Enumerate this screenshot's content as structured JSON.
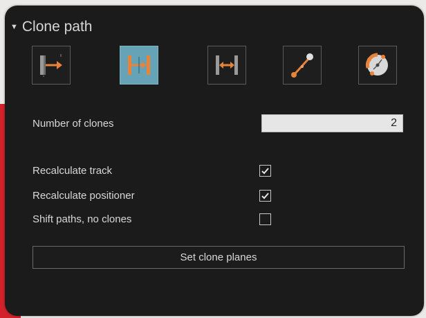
{
  "panel": {
    "title": "Clone path",
    "number_of_clones_label": "Number of clones",
    "number_of_clones_value": "2",
    "options": [
      {
        "label": "Recalculate track",
        "checked": true
      },
      {
        "label": "Recalculate positioner",
        "checked": true
      },
      {
        "label": "Shift paths, no clones",
        "checked": false
      }
    ],
    "set_clone_planes_label": "Set clone planes"
  },
  "modes": [
    {
      "icon": "clone-offset-icon",
      "active": false
    },
    {
      "icon": "clone-mirror-icon",
      "active": true
    },
    {
      "icon": "clone-span-icon",
      "active": false
    },
    {
      "icon": "clone-line-icon",
      "active": false
    },
    {
      "icon": "clone-rotate-icon",
      "active": false
    }
  ],
  "colors": {
    "panel_bg": "#1b1b1b",
    "active_mode": "#67a3b6",
    "accent_orange": "#e8833a",
    "brand_red": "#d3212b"
  }
}
